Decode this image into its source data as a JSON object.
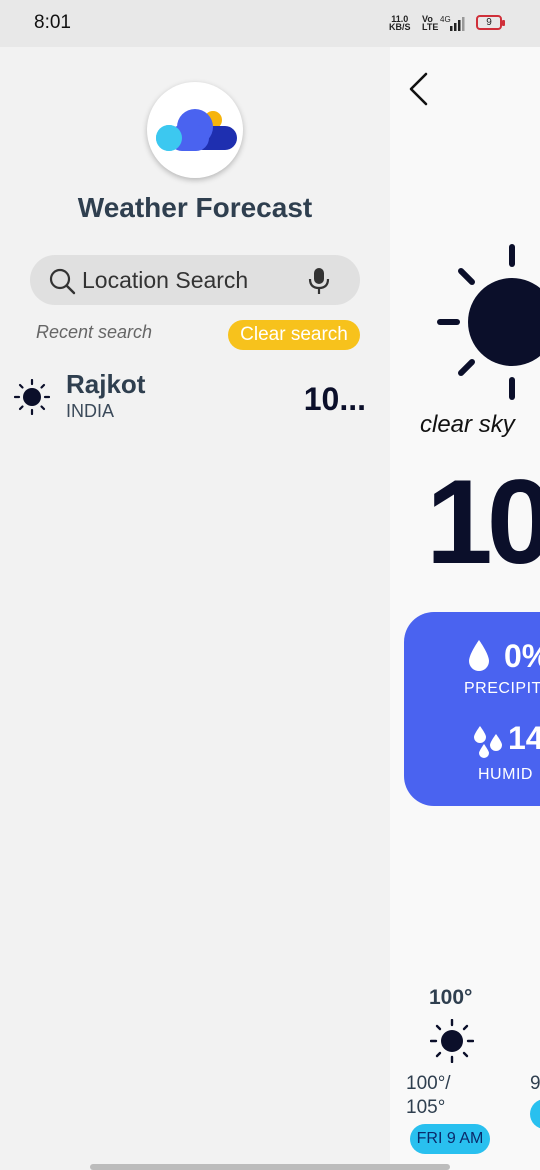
{
  "status_bar": {
    "time": "8:01",
    "net_speed": "11.0",
    "net_unit": "KB/S",
    "volte_top": "Vo",
    "volte_bottom": "LTE",
    "network": "4G",
    "battery": "9"
  },
  "drawer": {
    "app_title": "Weather Forecast",
    "search": {
      "placeholder": "Location Search"
    },
    "recent_label": "Recent search",
    "clear_label": "Clear search",
    "recent_items": [
      {
        "city": "Rajkot",
        "country": "INDIA",
        "temp": "10...",
        "icon": "sun-icon"
      }
    ]
  },
  "main": {
    "condition": "clear sky",
    "temperature": "10",
    "precipitation_value": "0%",
    "precipitation_label": "PRECIPIT",
    "humidity_value": "14",
    "humidity_label": "HUMID",
    "hourly": [
      {
        "temp": "100°",
        "range_line1": "100°/",
        "range_line2": "105°",
        "time": "FRI 9 AM"
      },
      {
        "range_line1": "9"
      }
    ]
  },
  "colors": {
    "accent_blue": "#4a63f0",
    "clear_button": "#f7c21c",
    "hour_pill": "#29c0ef",
    "text_dark": "#2f3f4f"
  }
}
